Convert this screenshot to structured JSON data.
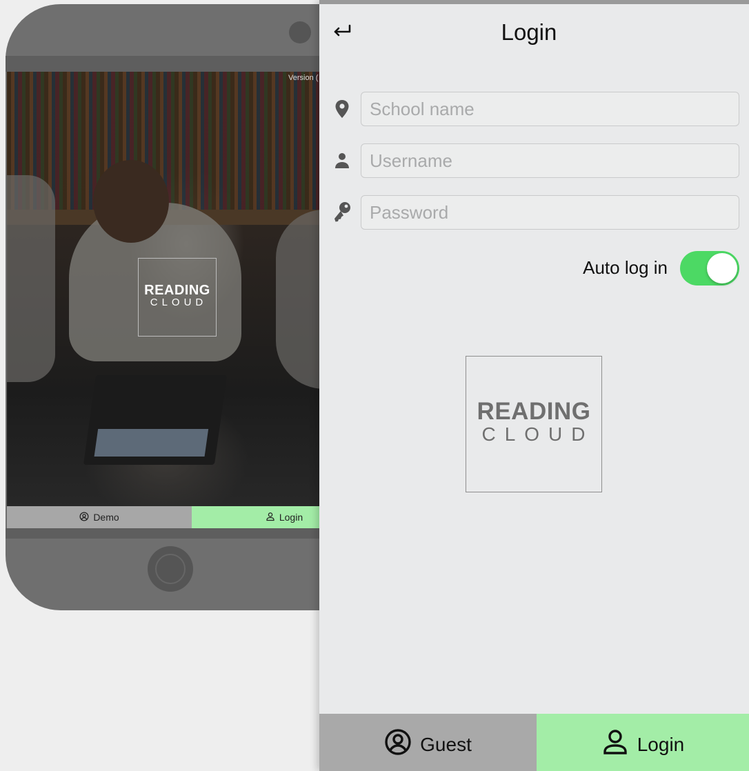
{
  "phone_preview": {
    "version_text": "Version (",
    "logo": {
      "line1": "READING",
      "line2": "CLOUD"
    },
    "tabs": [
      {
        "label": "Demo",
        "icon": "user-circle-icon"
      },
      {
        "label": "Login",
        "icon": "user-icon"
      }
    ]
  },
  "login_screen": {
    "title": "Login",
    "back_icon": "return-arrow-icon",
    "fields": {
      "school": {
        "placeholder": "School name",
        "value": "",
        "icon": "location-pin-icon"
      },
      "username": {
        "placeholder": "Username",
        "value": "",
        "icon": "person-icon"
      },
      "password": {
        "placeholder": "Password",
        "value": "",
        "icon": "key-icon"
      }
    },
    "auto_login": {
      "label": "Auto log in",
      "enabled": true
    },
    "logo": {
      "line1": "READING",
      "line2": "CLOUD"
    },
    "tabs": [
      {
        "label": "Guest",
        "icon": "user-circle-icon",
        "selected": false
      },
      {
        "label": "Login",
        "icon": "user-icon",
        "selected": true
      }
    ]
  },
  "colors": {
    "panel_background": "#e9eaeb",
    "toggle_on": "#4cd964",
    "login_tab": "#a3eda7",
    "guest_tab": "#a9a9a9",
    "phone_body": "#6f6f6f"
  }
}
